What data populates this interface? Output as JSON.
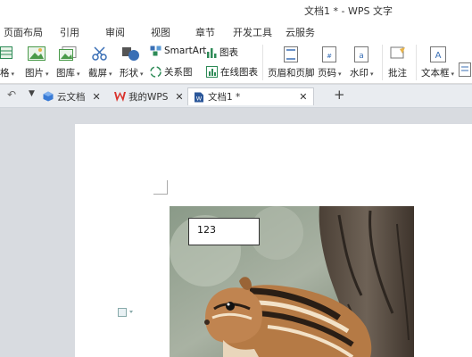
{
  "window": {
    "title": "文档1 * - WPS 文字"
  },
  "menu_tabs": [
    "页面布局",
    "引用",
    "审阅",
    "视图",
    "章节",
    "开发工具",
    "云服务"
  ],
  "ribbon": {
    "table_partial": "格",
    "picture": "图片",
    "gallery": "图库",
    "screenshot": "截屏",
    "shapes": "形状",
    "smartart": "SmartArt",
    "chart": "图表",
    "relation": "关系图",
    "online_chart": "在线图表",
    "header_footer": "页眉和页脚",
    "page_number": "页码",
    "watermark": "水印",
    "comment": "批注",
    "textbox": "文本框"
  },
  "doc_tabs": {
    "cloud": "云文档",
    "mywps": "我的WPS",
    "doc1": "文档1 *",
    "add": "+"
  },
  "document": {
    "textbox_value": "123"
  },
  "colors": {
    "accent": "#2b579a",
    "wps_red": "#d9322b"
  }
}
